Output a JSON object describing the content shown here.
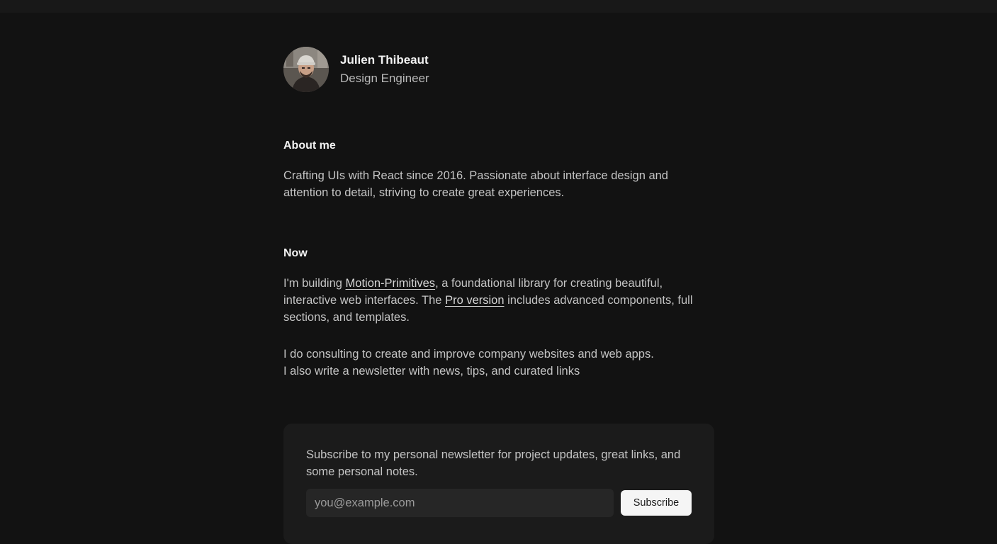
{
  "profile": {
    "name": "Julien Thibeaut",
    "role": "Design Engineer"
  },
  "about": {
    "heading": "About me",
    "text": "Crafting UIs with React since 2016. Passionate about interface design and attention to detail, striving to create great experiences."
  },
  "now": {
    "heading": "Now",
    "paragraph1": {
      "prefix": "I'm building ",
      "link1_label": "Motion-Primitives",
      "middle": ", a foundational library for creating beautiful, interactive web interfaces. The ",
      "link2_label": "Pro version",
      "suffix": " includes advanced components, full sections, and templates."
    },
    "paragraph2_line1": "I do consulting to create and improve company websites and web apps.",
    "paragraph2_line2": "I also write a newsletter with news, tips, and curated links"
  },
  "newsletter": {
    "description": "Subscribe to my personal newsletter for project updates, great links, and some personal notes.",
    "email_placeholder": "you@example.com",
    "email_value": "",
    "button_label": "Subscribe"
  }
}
